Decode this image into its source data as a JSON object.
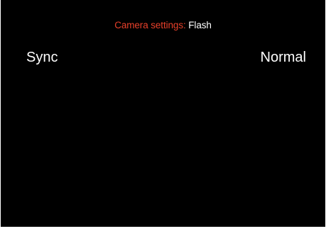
{
  "header": {
    "prefix": "Camera settings: ",
    "section": "Flash"
  },
  "settings": [
    {
      "label": "Sync",
      "value": "Normal"
    }
  ],
  "colors": {
    "background": "#000000",
    "accent": "#e8402a",
    "text": "#ffffff"
  }
}
